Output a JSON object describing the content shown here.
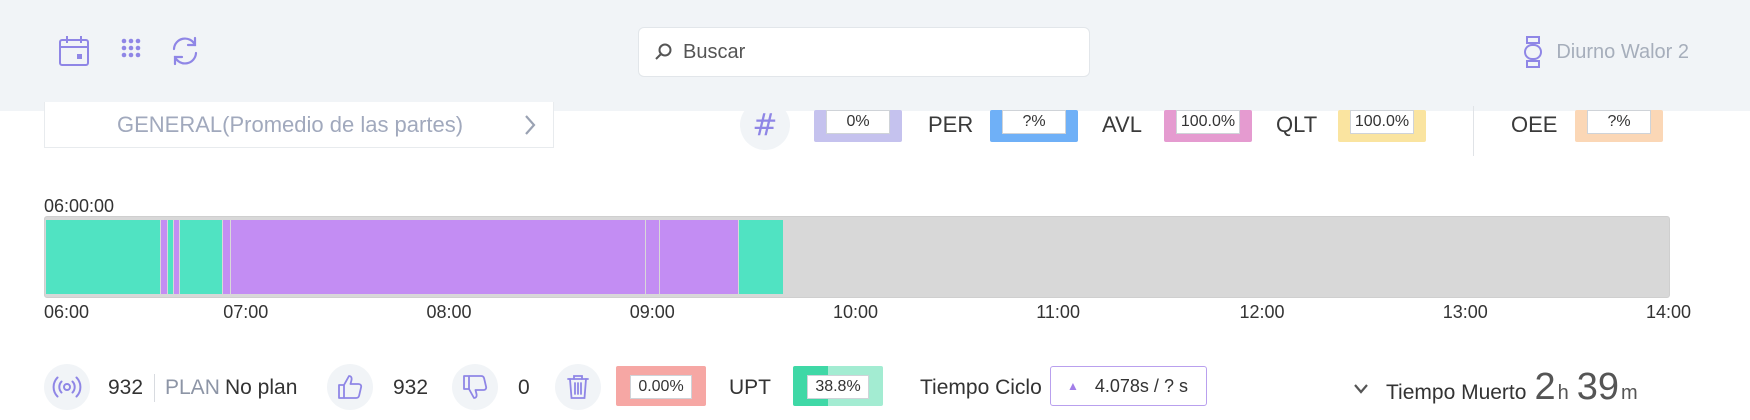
{
  "topbar": {
    "search_placeholder": "Buscar",
    "device_name": "Diurno Walor 2",
    "icons": [
      "calendar-icon",
      "grid-icon",
      "refresh-icon",
      "watch-icon"
    ]
  },
  "selector": {
    "label": "GENERAL(Promedio de las partes)"
  },
  "kpis": {
    "first": {
      "value": "0%",
      "color": "#c5c2ee"
    },
    "per": {
      "label": "PER",
      "value": "?%",
      "color": "#6fb0f7"
    },
    "avl": {
      "label": "AVL",
      "value": "100.0%",
      "color": "#e59bd0"
    },
    "qlt": {
      "label": "QLT",
      "value": "100.0%",
      "color": "#fae4a0"
    },
    "oee": {
      "label": "OEE",
      "value": "?%",
      "color": "#fbd7b6"
    }
  },
  "timeline": {
    "start_label": "06:00:00",
    "range_hours": [
      6,
      14
    ],
    "tick_labels": [
      "06:00",
      "07:00",
      "08:00",
      "09:00",
      "10:00",
      "11:00",
      "12:00",
      "13:00",
      "14:00"
    ],
    "colors": {
      "run": "#50e3c2",
      "stop": "#c38df3",
      "empty": "#d8d8d8"
    },
    "segments": [
      {
        "start": 6.0,
        "end": 6.567,
        "state": "run"
      },
      {
        "start": 6.567,
        "end": 6.6,
        "state": "stop"
      },
      {
        "start": 6.6,
        "end": 6.63,
        "state": "run"
      },
      {
        "start": 6.63,
        "end": 6.66,
        "state": "stop"
      },
      {
        "start": 6.66,
        "end": 6.87,
        "state": "run"
      },
      {
        "start": 6.87,
        "end": 6.91,
        "state": "stop"
      },
      {
        "start": 6.91,
        "end": 8.95,
        "state": "stop"
      },
      {
        "start": 8.95,
        "end": 9.02,
        "state": "stop"
      },
      {
        "start": 9.02,
        "end": 9.41,
        "state": "stop"
      },
      {
        "start": 9.41,
        "end": 9.63,
        "state": "run"
      }
    ]
  },
  "stats": {
    "counter_value": "932",
    "plan_label": "PLAN",
    "plan_value": "No plan",
    "good_value": "932",
    "bad_value": "0",
    "scrap_pct": "0.00%",
    "scrap_color": "#f6a7a4",
    "upt_label": "UPT",
    "upt_value": "38.8%",
    "upt_progress": 0.388,
    "upt_color": "#3fd8a6",
    "upt_bg": "#a3ecd2",
    "cycle_label": "Tiempo Ciclo",
    "cycle_value": "4.078s / ? s",
    "dead_label": "Tiempo Muerto",
    "dead_hours": "2",
    "dead_hours_unit": "h",
    "dead_minutes": "39",
    "dead_minutes_unit": "m"
  }
}
